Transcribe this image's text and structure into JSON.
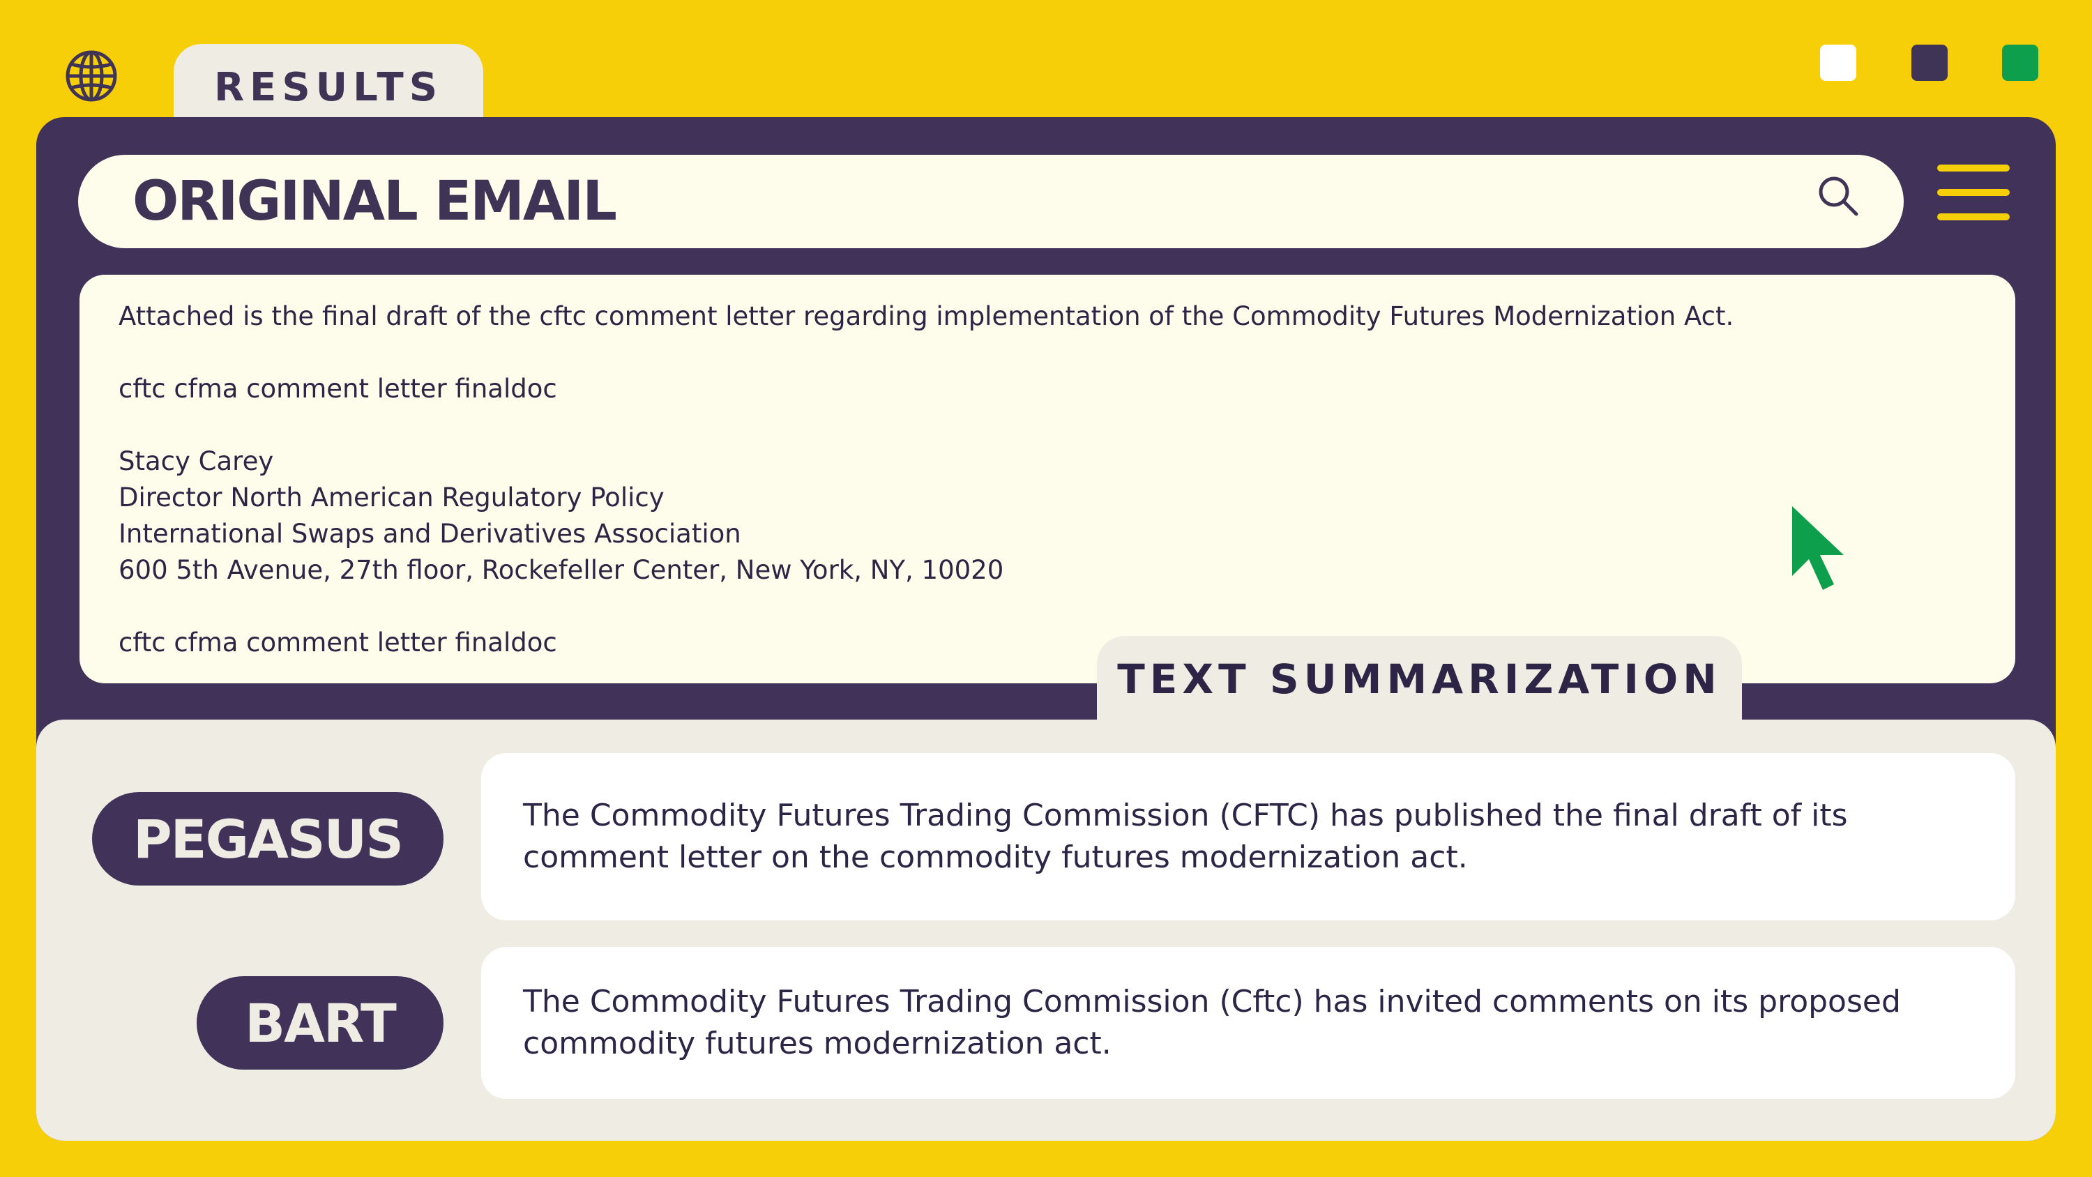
{
  "tabs": {
    "results_label": "RESULTS",
    "summary_label": "TEXT SUMMARIZATION"
  },
  "search": {
    "title": "ORIGINAL EMAIL"
  },
  "email": {
    "lines": [
      "Attached is the final draft of the cftc comment letter regarding implementation of the Commodity Futures Modernization Act.",
      "",
      "cftc cfma comment letter finaldoc",
      "",
      "Stacy Carey",
      "Director North American Regulatory Policy",
      "International Swaps and Derivatives Association",
      "600 5th Avenue, 27th floor, Rockefeller Center, New York, NY, 10020",
      "",
      "cftc cfma comment letter finaldoc"
    ]
  },
  "models": [
    {
      "name": "PEGASUS",
      "summary": "The Commodity Futures Trading Commission (CFTC) has published the final draft of its comment letter on the commodity futures modernization act."
    },
    {
      "name": "BART",
      "summary": "The Commodity Futures Trading Commission (Cftc) has invited comments on its proposed commodity futures modernization act."
    }
  ],
  "colors": {
    "background": "#F6CF08",
    "window": "#41325A",
    "panel": "#FEFDEB",
    "lower_panel": "#EFEDE3",
    "accent_green": "#0E9F4D",
    "text_dark": "#2D2545"
  },
  "icons": {
    "top_left": "globe-icon",
    "search": "search-icon",
    "menu": "hamburger-menu-icon",
    "pointer": "cursor-arrow-icon"
  }
}
